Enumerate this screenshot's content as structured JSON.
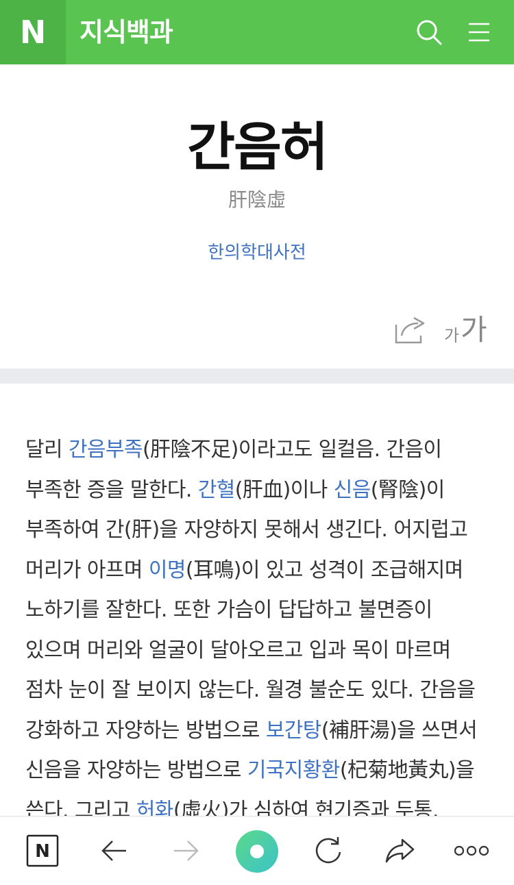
{
  "header": {
    "logo": "N",
    "title": "지식백과"
  },
  "entry": {
    "title": "간음허",
    "hanja": "肝陰虛",
    "source": "한의학대사전",
    "font_small": "가",
    "font_large": "가"
  },
  "article": {
    "segments": [
      {
        "t": "달리 "
      },
      {
        "t": "간음부족",
        "link": true
      },
      {
        "t": "(肝陰不足)이라고도 일컬음. 간음이 부족한 증을 말한다. "
      },
      {
        "t": "간혈",
        "link": true
      },
      {
        "t": "(肝血)이나 "
      },
      {
        "t": "신음",
        "link": true
      },
      {
        "t": "(腎陰)이 부족하여 간(肝)을 자양하지 못해서 생긴다. 어지럽고 머리가 아프며 "
      },
      {
        "t": "이명",
        "link": true
      },
      {
        "t": "(耳鳴)이 있고 성격이 조급해지며 노하기를 잘한다. 또한 가슴이 답답하고 불면증이 있으며 머리와 얼굴이 달아오르고 입과 목이 마르며 점차 눈이 잘 보이지 않는다. 월경 불순도 있다. 간음을 강화하고 자양하는 방법으로 "
      },
      {
        "t": "보간탕",
        "link": true
      },
      {
        "t": "(補肝湯)을 쓰면서 신음을 자양하는 방법으로 "
      },
      {
        "t": "기국지황환",
        "link": true
      },
      {
        "t": "(杞菊地黃丸)을 쓴다. 그리고 "
      },
      {
        "t": "허화",
        "link": true
      },
      {
        "t": "(虛火)가 심하여 현기증과 두통,"
      }
    ]
  },
  "bottom_bar": {
    "home_logo": "N"
  },
  "colors": {
    "header_green": "#5ac451",
    "logo_green": "#4db347",
    "link_blue": "#3f72c2",
    "divider_gray": "#e9ebee"
  },
  "icons": [
    "search-icon",
    "menu-icon",
    "share-icon",
    "back-arrow-icon",
    "forward-arrow-icon",
    "refresh-icon",
    "share-arrow-icon",
    "more-icon"
  ]
}
